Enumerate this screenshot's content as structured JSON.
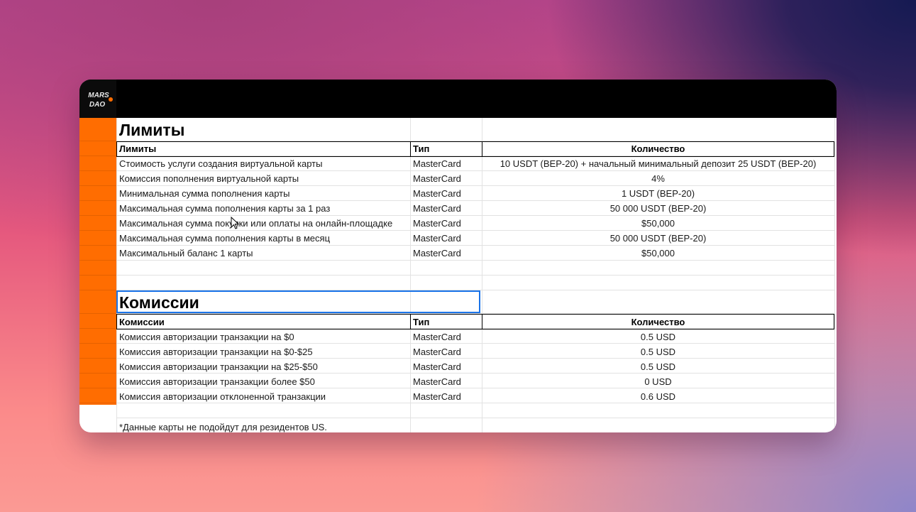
{
  "brand": {
    "logo_line1": "MARS",
    "logo_line2": "DAO"
  },
  "limits": {
    "title": "Лимиты",
    "headers": [
      "Лимиты",
      "Тип",
      "Количество"
    ],
    "rows": [
      [
        "Стоимость услуги создания виртуальной карты",
        "MasterCard",
        "10 USDT (BEP-20) + начальный минимальный депозит 25 USDT (BEP-20)"
      ],
      [
        "Комиссия пополнения виртуальной карты",
        "MasterCard",
        "4%"
      ],
      [
        "Минимальная сумма пополнения карты",
        "MasterCard",
        "1 USDT (BEP-20)"
      ],
      [
        "Максимальная сумма пополнения карты за 1 раз",
        "MasterCard",
        "50 000 USDT (BEP-20)"
      ],
      [
        "Максимальная сумма покупки или оплаты на онлайн-площадке",
        "MasterCard",
        "$50,000"
      ],
      [
        "Максимальная сумма пополнения карты в месяц",
        "MasterCard",
        "50 000 USDT (BEP-20)"
      ],
      [
        "Максимальный баланс 1 карты",
        "MasterCard",
        "$50,000"
      ]
    ]
  },
  "fees": {
    "title": "Комиссии",
    "headers": [
      "Комиссии",
      "Тип",
      "Количество"
    ],
    "rows": [
      [
        "Комиссия авторизации транзакции на $0",
        "MasterCard",
        "0.5 USD"
      ],
      [
        "Комиссия авторизации транзакции на $0-$25",
        "MasterCard",
        "0.5 USD"
      ],
      [
        "Комиссия авторизации транзакции на $25-$50",
        "MasterCard",
        "0.5 USD"
      ],
      [
        "Комиссия авторизации транзакции более $50",
        "MasterCard",
        "0 USD"
      ],
      [
        "Комиссия авторизации отклоненной транзакции",
        "MasterCard",
        "0.6 USD"
      ]
    ]
  },
  "footnote": "*Данные карты не подойдут для резидентов US.",
  "colors": {
    "accent_orange": "#ff6d01",
    "header_bar": "#000000",
    "selection": "#1a73e8"
  }
}
